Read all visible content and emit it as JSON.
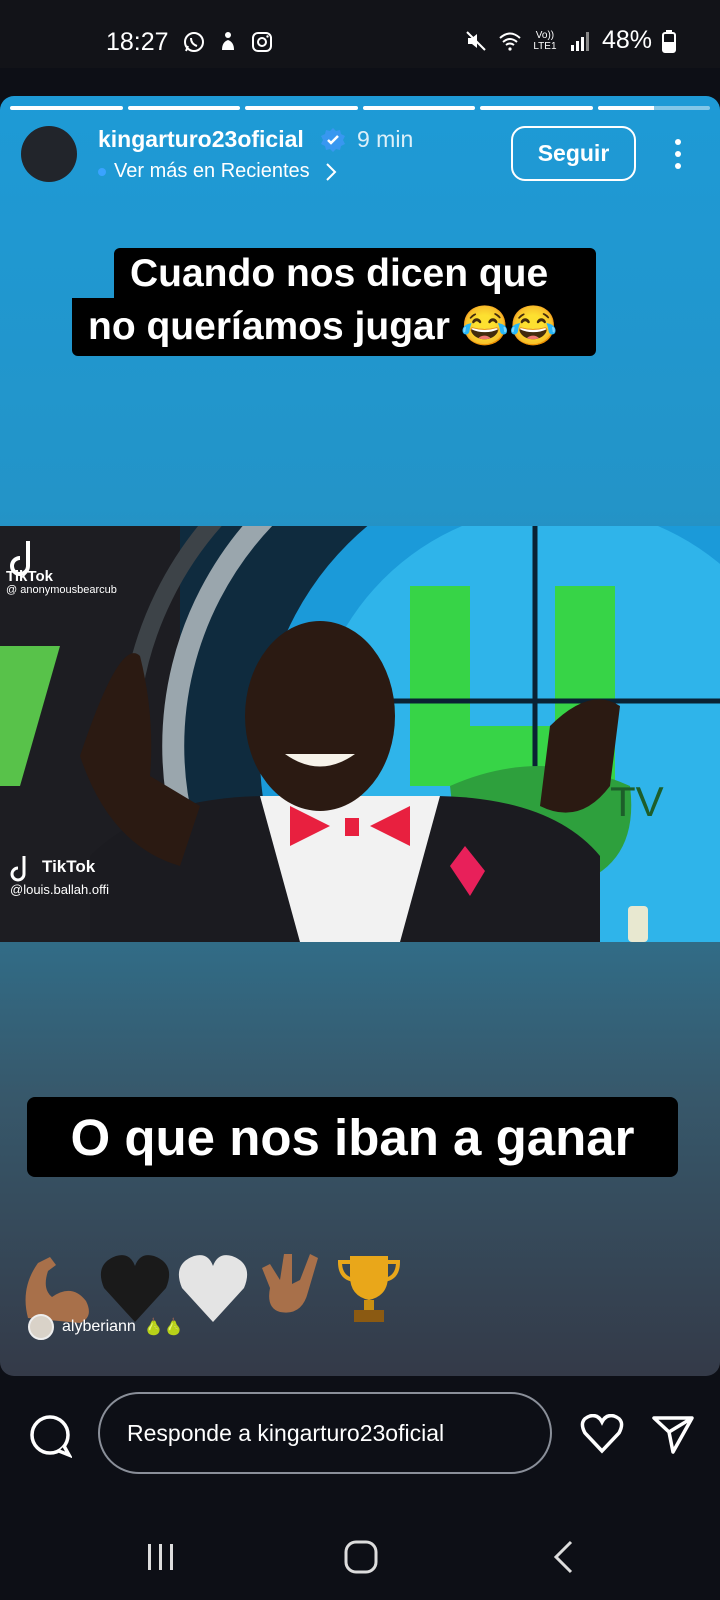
{
  "status_bar": {
    "time": "18:27",
    "left_icons": [
      "whatsapp-icon",
      "notification-icon",
      "instagram-icon"
    ],
    "right_icons": [
      "mute-icon",
      "wifi-icon",
      "volte-icon",
      "signal-icon"
    ],
    "volte_label": "Vo)) LTE1",
    "battery": "48%"
  },
  "story": {
    "progress_segments": 6,
    "active_segment": 6,
    "active_progress": 0.5,
    "username": "kingarturo23oficial",
    "verified": true,
    "time_ago": "9 min",
    "subtitle": "Ver más en Recientes",
    "follow_label": "Seguir",
    "caption_top_line1": "Cuando nos dicen que",
    "caption_top_line2": "no queríamos jugar 😂😂",
    "video": {
      "watermark_top_brand": "TikTok",
      "watermark_top_handle": "@ anonymousbearcub",
      "watermark_bottom_brand": "TikTok",
      "watermark_bottom_handle": "@louis.ballah.offi",
      "screen_logo_text": "TV"
    },
    "caption_bottom": "O que nos iban a ganar",
    "emojis": [
      "💪🏽",
      "🖤",
      "🤍",
      "🤟🏽",
      "🏆"
    ],
    "mention": {
      "username": "alyberiann",
      "emojis": "🍐🍐"
    }
  },
  "reply_bar": {
    "placeholder": "Responde a kingarturo23oficial"
  },
  "nav_bar": {
    "buttons": [
      "recents-icon",
      "home-icon",
      "back-icon"
    ]
  },
  "colors": {
    "story_top": "#1e9ad6",
    "story_bottom": "#343a48",
    "background": "#0d0f16",
    "verified_blue": "#3897f0"
  }
}
